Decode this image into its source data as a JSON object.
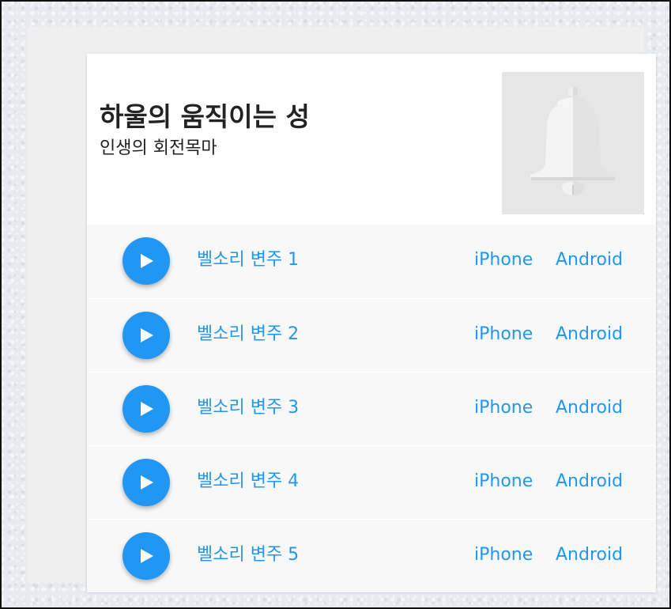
{
  "header": {
    "title": "하울의 움직이는 성",
    "subtitle": "인생의 회전목마",
    "artwork_icon": "bell-icon"
  },
  "tracks": [
    {
      "name": "벨소리 변주 1",
      "iphone_label": "iPhone",
      "android_label": "Android"
    },
    {
      "name": "벨소리 변주 2",
      "iphone_label": "iPhone",
      "android_label": "Android"
    },
    {
      "name": "벨소리 변주 3",
      "iphone_label": "iPhone",
      "android_label": "Android"
    },
    {
      "name": "벨소리 변주 4",
      "iphone_label": "iPhone",
      "android_label": "Android"
    },
    {
      "name": "벨소리 변주 5",
      "iphone_label": "iPhone",
      "android_label": "Android"
    }
  ],
  "play_icon": "play-icon",
  "colors": {
    "accent": "#2196f3",
    "text": "#222222",
    "row_background": "#f8f8f8",
    "artwork_background": "#e6e6e6"
  }
}
